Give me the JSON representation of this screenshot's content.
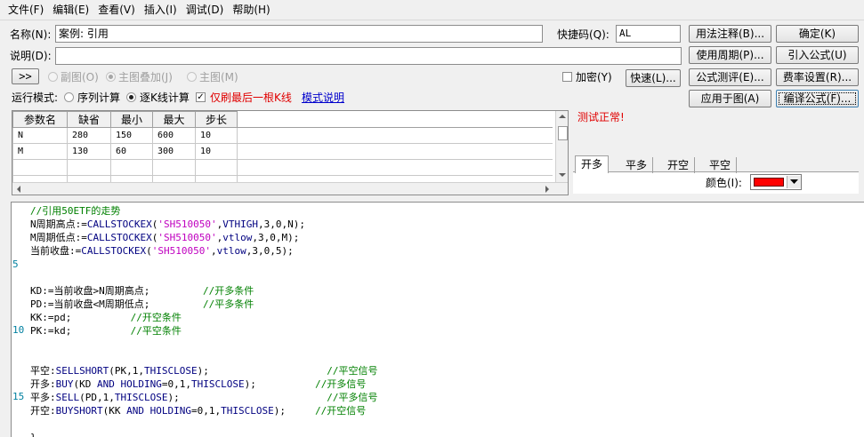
{
  "menu": [
    "文件(F)",
    "编辑(E)",
    "查看(V)",
    "插入(I)",
    "调试(D)",
    "帮助(H)"
  ],
  "form": {
    "name_label": "名称(N):",
    "name_value": "案例: 引用",
    "shortcut_label": "快捷码(Q):",
    "shortcut_value": "AL",
    "desc_label": "说明(D):",
    "desc_value": ""
  },
  "buttons": {
    "usage_note": "用法注释(B)...",
    "ok": "确定(K)",
    "use_period": "使用周期(P)...",
    "import_formula": "引入公式(U)",
    "formula_test": "公式测评(E)...",
    "fee_settings": "费率设置(R)...",
    "apply_to_chart": "应用于图(A)",
    "compile_formula": "编译公式(F)...",
    "expand": ">>",
    "encrypt": "加密(Y)",
    "quick": "快速(L)..."
  },
  "chart_mode": {
    "sub_chart": "副图(O)",
    "main_overlay": "主图叠加(J)",
    "main_chart": "主图(M)"
  },
  "run_mode": {
    "label": "运行模式:",
    "serial_calc": "序列计算",
    "kline_calc": "逐K线计算",
    "refresh_last": "仅刷最后一根K线",
    "mode_help_link": "模式说明"
  },
  "params": {
    "headers": [
      "参数名",
      "缺省",
      "最小",
      "最大",
      "步长"
    ],
    "rows": [
      [
        "N",
        "280",
        "150",
        "600",
        "10"
      ],
      [
        "M",
        "130",
        "60",
        "300",
        "10"
      ]
    ]
  },
  "status": {
    "test_message": "测试正常!"
  },
  "signal_tabs": [
    "开多",
    "平多",
    "开空",
    "平空"
  ],
  "color_picker": {
    "label": "颜色(I):",
    "value": "#ff0000"
  },
  "code": {
    "line_numbers": [
      "5",
      "10",
      "15"
    ],
    "lines": [
      [
        {
          "t": "//引用50ETF的走势",
          "c": "comment"
        }
      ],
      [
        {
          "t": "N周期高点:=",
          "c": "plain"
        },
        {
          "t": "CALLSTOCKEX",
          "c": "func"
        },
        {
          "t": "(",
          "c": "plain"
        },
        {
          "t": "'SH510050'",
          "c": "string"
        },
        {
          "t": ",",
          "c": "plain"
        },
        {
          "t": "VTHIGH",
          "c": "func"
        },
        {
          "t": ",3,0,N);",
          "c": "plain"
        }
      ],
      [
        {
          "t": "M周期低点:=",
          "c": "plain"
        },
        {
          "t": "CALLSTOCKEX",
          "c": "func"
        },
        {
          "t": "(",
          "c": "plain"
        },
        {
          "t": "'SH510050'",
          "c": "string"
        },
        {
          "t": ",",
          "c": "plain"
        },
        {
          "t": "vtlow",
          "c": "func"
        },
        {
          "t": ",3,0,M);",
          "c": "plain"
        }
      ],
      [
        {
          "t": "当前收盘:=",
          "c": "plain"
        },
        {
          "t": "CALLSTOCKEX",
          "c": "func"
        },
        {
          "t": "(",
          "c": "plain"
        },
        {
          "t": "'SH510050'",
          "c": "string"
        },
        {
          "t": ",",
          "c": "plain"
        },
        {
          "t": "vtlow",
          "c": "func"
        },
        {
          "t": ",3,0,5);",
          "c": "plain"
        }
      ],
      [],
      [],
      [
        {
          "t": "KD:=当前收盘>N周期高点;         ",
          "c": "plain"
        },
        {
          "t": "//开多条件",
          "c": "comment"
        }
      ],
      [
        {
          "t": "PD:=当前收盘<M周期低点;         ",
          "c": "plain"
        },
        {
          "t": "//平多条件",
          "c": "comment"
        }
      ],
      [
        {
          "t": "KK:=pd;          ",
          "c": "plain"
        },
        {
          "t": "//开空条件",
          "c": "comment"
        }
      ],
      [
        {
          "t": "PK:=kd;          ",
          "c": "plain"
        },
        {
          "t": "//平空条件",
          "c": "comment"
        }
      ],
      [],
      [],
      [
        {
          "t": "平空:",
          "c": "plain"
        },
        {
          "t": "SELLSHORT",
          "c": "func"
        },
        {
          "t": "(PK,1,",
          "c": "plain"
        },
        {
          "t": "THISCLOSE",
          "c": "func"
        },
        {
          "t": ");                    ",
          "c": "plain"
        },
        {
          "t": "//平空信号",
          "c": "comment"
        }
      ],
      [
        {
          "t": "开多:",
          "c": "plain"
        },
        {
          "t": "BUY",
          "c": "func"
        },
        {
          "t": "(KD ",
          "c": "plain"
        },
        {
          "t": "AND",
          "c": "func"
        },
        {
          "t": " ",
          "c": "plain"
        },
        {
          "t": "HOLDING",
          "c": "func"
        },
        {
          "t": "=0,1,",
          "c": "plain"
        },
        {
          "t": "THISCLOSE",
          "c": "func"
        },
        {
          "t": ");          ",
          "c": "plain"
        },
        {
          "t": "//开多信号",
          "c": "comment"
        }
      ],
      [
        {
          "t": "平多:",
          "c": "plain"
        },
        {
          "t": "SELL",
          "c": "func"
        },
        {
          "t": "(PD,1,",
          "c": "plain"
        },
        {
          "t": "THISCLOSE",
          "c": "func"
        },
        {
          "t": ");                         ",
          "c": "plain"
        },
        {
          "t": "//平多信号",
          "c": "comment"
        }
      ],
      [
        {
          "t": "开空:",
          "c": "plain"
        },
        {
          "t": "BUYSHORT",
          "c": "func"
        },
        {
          "t": "(KK ",
          "c": "plain"
        },
        {
          "t": "AND",
          "c": "func"
        },
        {
          "t": " ",
          "c": "plain"
        },
        {
          "t": "HOLDING",
          "c": "func"
        },
        {
          "t": "=0,1,",
          "c": "plain"
        },
        {
          "t": "THISCLOSE",
          "c": "func"
        },
        {
          "t": ");     ",
          "c": "plain"
        },
        {
          "t": "//开空信号",
          "c": "comment"
        }
      ],
      [],
      [
        {
          "t": "}",
          "c": "plain"
        }
      ]
    ]
  },
  "colors": {
    "comment": "#008000",
    "func": "#000080",
    "string": "#c000c0",
    "plain": "#000000",
    "status_red": "#e00000",
    "link_blue": "#0000cc"
  }
}
